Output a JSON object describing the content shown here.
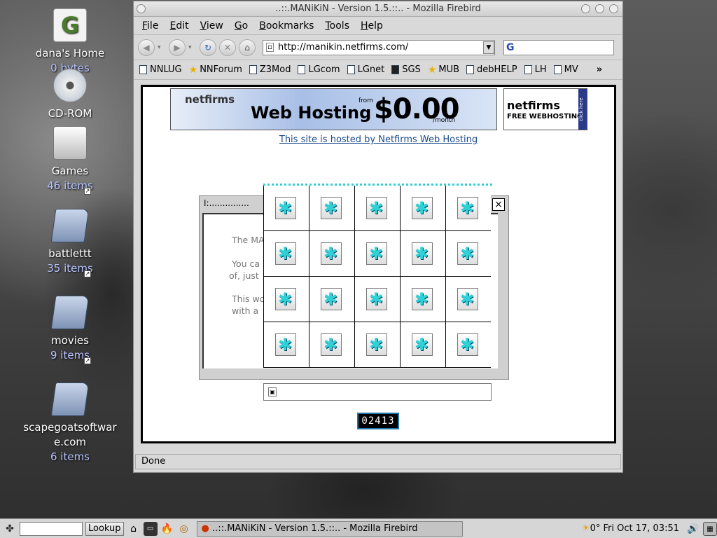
{
  "desktop": {
    "icons": [
      {
        "name": "dana's Home",
        "sub": "0 bytes"
      },
      {
        "name": "CD-ROM",
        "sub": ""
      },
      {
        "name": "Games",
        "sub": "46 items"
      },
      {
        "name": "battlettt",
        "sub": "35 items"
      },
      {
        "name": "movies",
        "sub": "9 items"
      },
      {
        "name": "scapegoatsoftware.com",
        "sub": "6 items"
      }
    ]
  },
  "window": {
    "title": "..::.MANiKiN - Version 1.5.::.. - Mozilla Firebird",
    "menu": [
      "File",
      "Edit",
      "View",
      "Go",
      "Bookmarks",
      "Tools",
      "Help"
    ],
    "url": "http://manikin.netfirms.com/",
    "search_placeholder": "G",
    "bookmarks": [
      "NNLUG",
      "NNForum",
      "Z3Mod",
      "LGcom",
      "LGnet",
      "SGS",
      "MUB",
      "debHELP",
      "LH",
      "MV"
    ],
    "bookmarks_more": "»",
    "status": "Done"
  },
  "page": {
    "banner1": {
      "logo": "netfirms",
      "text": "Web Hosting",
      "from": "from",
      "price": "$0.00",
      "per": "/month"
    },
    "banner2": {
      "logo": "netfirms",
      "free": "FREE WEBHOSTING",
      "click": "click here"
    },
    "hosted_link": "This site is hosted by Netfirms Web Hosting",
    "dialog": {
      "title": "I:...............",
      "close": "×",
      "lines": [
        "The MA",
        "You ca",
        "of, just",
        "This wo",
        "with a"
      ]
    },
    "counter": "02413"
  },
  "taskbar": {
    "lookup": "Lookup",
    "task": "..::.MANiKiN - Version 1.5.::.. - Mozilla Firebird",
    "weather": "0°",
    "clock": "Fri Oct 17, 03:51"
  }
}
